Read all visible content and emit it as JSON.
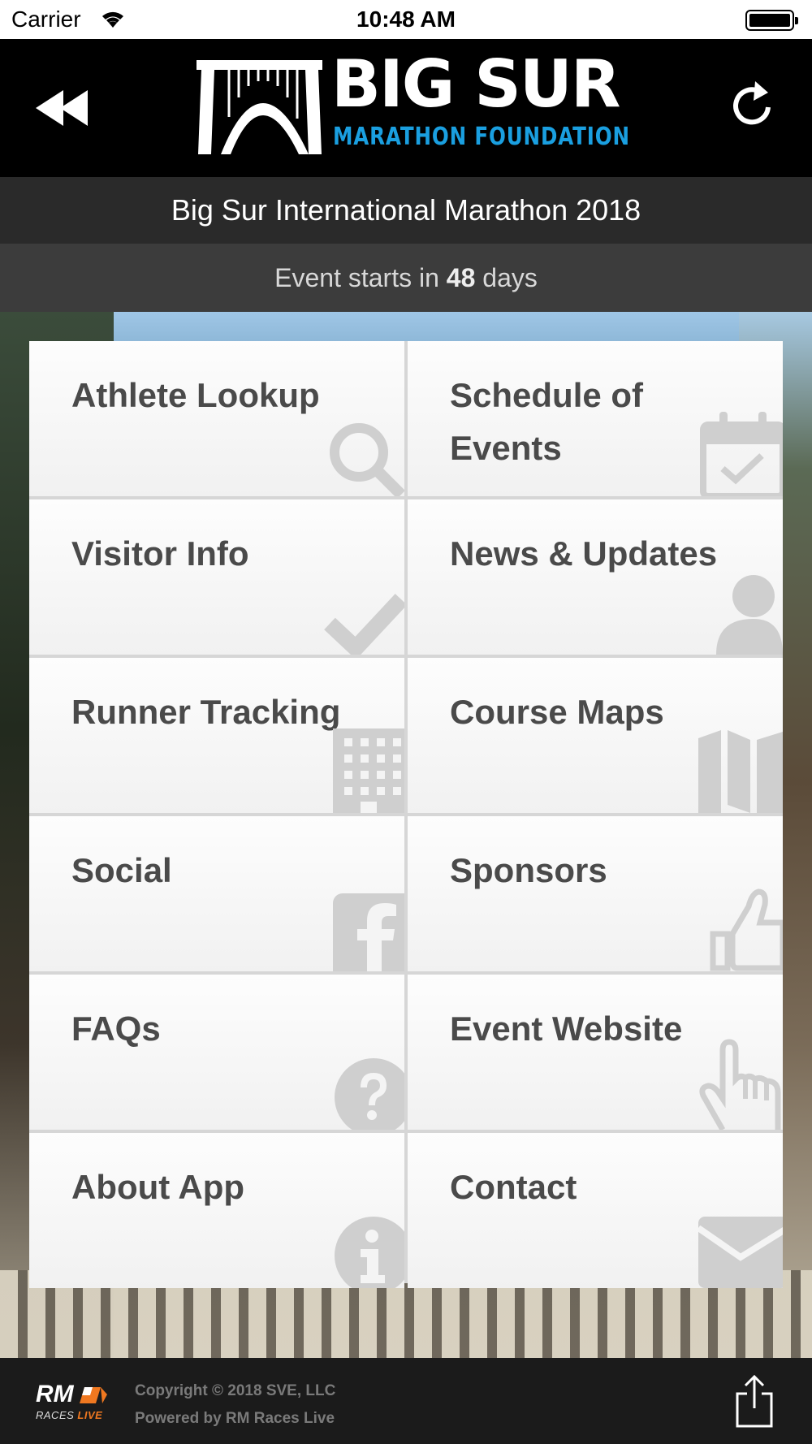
{
  "status_bar": {
    "carrier": "Carrier",
    "time": "10:48 AM"
  },
  "header": {
    "logo_title": "BIG SUR",
    "logo_subtitle": "MARATHON FOUNDATION"
  },
  "event_title": "Big Sur International Marathon 2018",
  "countdown": {
    "prefix": "Event starts in",
    "days": "48",
    "suffix": "days"
  },
  "menu": [
    {
      "label": "Athlete Lookup",
      "icon": "search-icon"
    },
    {
      "label": "Schedule of Events",
      "icon": "calendar-check-icon"
    },
    {
      "label": "Visitor Info",
      "icon": "checkmark-icon"
    },
    {
      "label": "News & Updates",
      "icon": "person-icon"
    },
    {
      "label": "Runner Tracking",
      "icon": "building-icon"
    },
    {
      "label": "Course Maps",
      "icon": "map-icon"
    },
    {
      "label": "Social",
      "icon": "facebook-icon"
    },
    {
      "label": "Sponsors",
      "icon": "thumbs-up-icon"
    },
    {
      "label": "FAQs",
      "icon": "question-icon"
    },
    {
      "label": "Event Website",
      "icon": "pointer-hand-icon"
    },
    {
      "label": "About App",
      "icon": "info-icon"
    },
    {
      "label": "Contact",
      "icon": "envelope-icon"
    }
  ],
  "footer": {
    "brand": "RM",
    "brand_sub": "RACES",
    "brand_live": "LIVE",
    "copyright": "Copyright © 2018 SVE, LLC",
    "powered_by": "Powered by RM Races Live"
  },
  "colors": {
    "accent_blue": "#1a9fe0",
    "tile_text": "#4a4a4a",
    "tile_icon": "#cfcfcf",
    "footer_orange": "#f07820"
  }
}
